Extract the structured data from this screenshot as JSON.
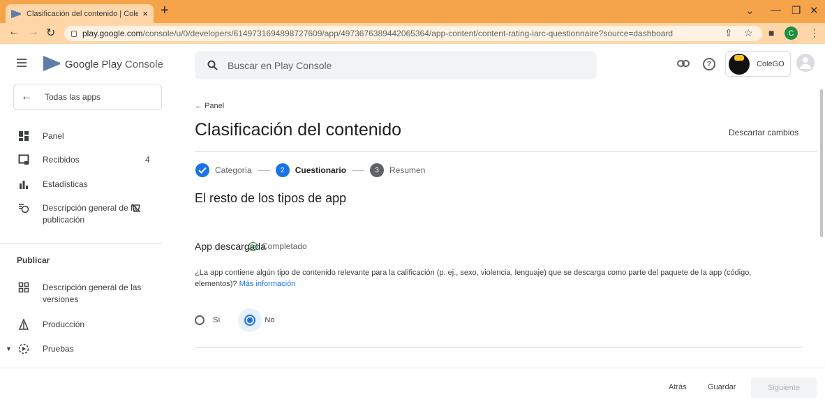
{
  "browser": {
    "tab_title": "Clasificación del contenido | Cole",
    "tab_close": "×",
    "new_tab": "+",
    "url_host": "play.google.com",
    "url_path": "/console/u/0/developers/6149731694898727609/app/4973676389442065364/app-content/content-rating-iarc-questionnaire?source=dashboard",
    "profile_initial": "C"
  },
  "header": {
    "brand_prefix": "Google Play",
    "brand_suffix": "Console",
    "search_placeholder": "Buscar en Play Console",
    "help_glyph": "?",
    "account_name": "ColeGO"
  },
  "sidebar": {
    "all_apps": "Todas las apps",
    "items": [
      {
        "label": "Panel"
      },
      {
        "label": "Recibidos",
        "badge": "4"
      },
      {
        "label": "Estadísticas"
      },
      {
        "label": "Descripción general de la publicación"
      }
    ],
    "section_label": "Publicar",
    "publish_items": [
      {
        "label": "Descripción general de las versiones"
      },
      {
        "label": "Producción"
      },
      {
        "label": "Pruebas"
      }
    ]
  },
  "main": {
    "back_label": "← Panel",
    "title": "Clasificación del contenido",
    "discard_label": "Descartar cambios",
    "steps": [
      {
        "label": "Categoría",
        "number": ""
      },
      {
        "label": "Cuestionario",
        "number": "2"
      },
      {
        "label": "Resumen",
        "number": "3"
      }
    ],
    "section_heading": "El resto de los tipos de app",
    "question": {
      "title": "App descargada",
      "status": "Completado",
      "body": "¿La app contiene algún tipo de contenido relevante para la calificación (p. ej., sexo, violencia, lenguaje) que se descarga como parte del paquete de la app (código, elementos)?",
      "more_info": "Más información",
      "options": [
        "Sí",
        "No"
      ],
      "selected": "No"
    }
  },
  "footer": {
    "back": "Atrás",
    "save": "Guardar",
    "next": "Siguiente"
  },
  "colors": {
    "tab_strip": "#f6a44a",
    "primary": "#1a73e8",
    "success": "#188038",
    "step_inactive": "#5f6368"
  },
  "icons": [
    "file-icon",
    "close-icon",
    "plus-icon",
    "back-arrow-icon",
    "forward-arrow-icon",
    "reload-icon",
    "lock-icon",
    "share-icon",
    "star-icon",
    "sidepanel-icon",
    "kebab-icon",
    "menu-icon",
    "play-console-logo",
    "search-icon",
    "link-icon",
    "help-icon",
    "dashboard-icon",
    "inbox-icon",
    "stats-icon",
    "publish-overview-icon",
    "releases-icon",
    "production-icon",
    "testing-icon",
    "check-icon"
  ]
}
